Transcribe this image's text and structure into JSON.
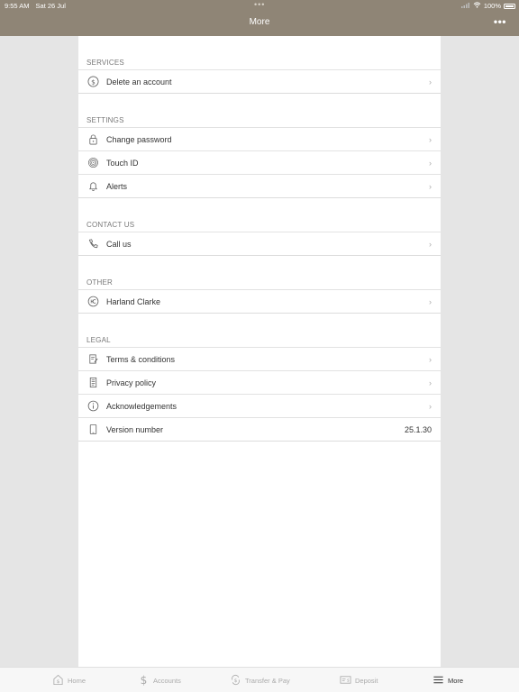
{
  "status_bar": {
    "time": "9:55 AM",
    "date": "Sat 26 Jul",
    "battery": "100%",
    "dots": "•••"
  },
  "header": {
    "title": "More",
    "more_label": "•••"
  },
  "sections": [
    {
      "title": "SERVICES",
      "items": [
        {
          "label": "Delete an account",
          "icon": "dollar-circle-icon"
        }
      ]
    },
    {
      "title": "SETTINGS",
      "items": [
        {
          "label": "Change password",
          "icon": "lock-icon"
        },
        {
          "label": "Touch ID",
          "icon": "fingerprint-icon"
        },
        {
          "label": "Alerts",
          "icon": "bell-icon"
        }
      ]
    },
    {
      "title": "CONTACT US",
      "items": [
        {
          "label": "Call us",
          "icon": "phone-icon"
        }
      ]
    },
    {
      "title": "OTHER",
      "items": [
        {
          "label": "Harland Clarke",
          "icon": "harland-clarke-icon"
        }
      ]
    },
    {
      "title": "LEGAL",
      "items": [
        {
          "label": "Terms & conditions",
          "icon": "document-pen-icon"
        },
        {
          "label": "Privacy policy",
          "icon": "document-lines-icon"
        },
        {
          "label": "Acknowledgements",
          "icon": "info-icon"
        },
        {
          "label": "Version number",
          "icon": "device-icon",
          "value": "25.1.30"
        }
      ]
    }
  ],
  "tabs": [
    {
      "label": "Home",
      "icon": "home-dollar-icon"
    },
    {
      "label": "Accounts",
      "icon": "dollar-icon"
    },
    {
      "label": "Transfer & Pay",
      "icon": "transfer-icon"
    },
    {
      "label": "Deposit",
      "icon": "check-deposit-icon"
    },
    {
      "label": "More",
      "icon": "menu-icon",
      "active": true
    }
  ],
  "chevron": "›"
}
